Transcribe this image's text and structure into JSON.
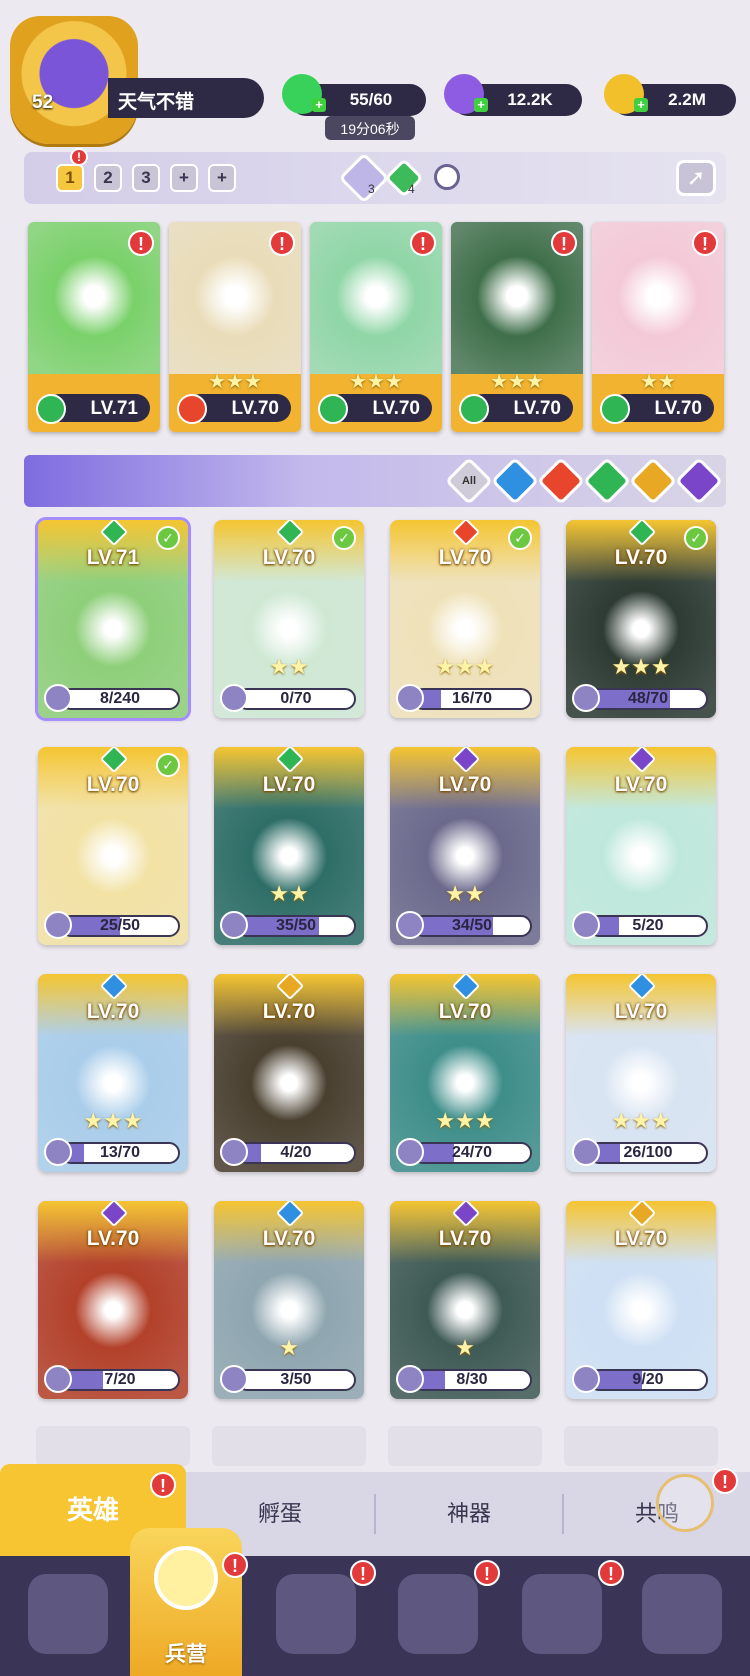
{
  "player": {
    "level": "52",
    "name": "天气不错"
  },
  "resources": {
    "energy": "55/60",
    "energy_timer": "19分06秒",
    "gems": "12.2K",
    "gold": "2.2M"
  },
  "teams": {
    "tabs": [
      "1",
      "2",
      "3",
      "+",
      "+"
    ],
    "active": 0,
    "count_a": "3",
    "count_b": "4"
  },
  "team_heroes": [
    {
      "level": "LV.71",
      "element": "wind",
      "stars": "",
      "color": "#7ad16a"
    },
    {
      "level": "LV.70",
      "element": "fire",
      "stars": "★★★",
      "color": "#e9dcb8"
    },
    {
      "level": "LV.70",
      "element": "wind",
      "stars": "★★★",
      "color": "#8fd6a6"
    },
    {
      "level": "LV.70",
      "element": "wind",
      "stars": "★★★",
      "color": "#3f6f4a"
    },
    {
      "level": "LV.70",
      "element": "wind",
      "stars": "★★",
      "color": "#f4c9d7"
    }
  ],
  "filters": [
    "All",
    "water",
    "fire",
    "wind",
    "light",
    "dark"
  ],
  "elements": {
    "wind": "#2fb553",
    "fire": "#e8462c",
    "water": "#2f8fe0",
    "light": "#e8a823",
    "dark": "#7a45c9"
  },
  "heroes": [
    {
      "level": "LV.71",
      "element": "wind",
      "progress": "8/240",
      "stars": "",
      "check": true,
      "color": "#8ecf7a",
      "sel": true
    },
    {
      "level": "LV.70",
      "element": "wind",
      "progress": "0/70",
      "stars": "★★",
      "check": true,
      "color": "#cfe8d4"
    },
    {
      "level": "LV.70",
      "element": "fire",
      "progress": "16/70",
      "stars": "★★★",
      "check": true,
      "color": "#efe2b9"
    },
    {
      "level": "LV.70",
      "element": "wind",
      "progress": "48/70",
      "stars": "★★★",
      "check": true,
      "color": "#2d3b33"
    },
    {
      "level": "LV.70",
      "element": "wind",
      "progress": "25/50",
      "stars": "",
      "check": true,
      "color": "#f2e2a4"
    },
    {
      "level": "LV.70",
      "element": "wind",
      "progress": "35/50",
      "stars": "★★",
      "check": false,
      "color": "#2e6e67"
    },
    {
      "level": "LV.70",
      "element": "dark",
      "progress": "34/50",
      "stars": "★★",
      "check": false,
      "color": "#6c6a8c"
    },
    {
      "level": "LV.70",
      "element": "dark",
      "progress": "5/20",
      "stars": "",
      "check": false,
      "color": "#bfe8dc"
    },
    {
      "level": "LV.70",
      "element": "water",
      "progress": "13/70",
      "stars": "★★★",
      "check": false,
      "color": "#a9cdea"
    },
    {
      "level": "LV.70",
      "element": "light",
      "progress": "4/20",
      "stars": "",
      "check": false,
      "color": "#4a4030"
    },
    {
      "level": "LV.70",
      "element": "water",
      "progress": "24/70",
      "stars": "★★★",
      "check": false,
      "color": "#3e8e8a"
    },
    {
      "level": "LV.70",
      "element": "water",
      "progress": "26/100",
      "stars": "★★★",
      "check": false,
      "color": "#d8e4f2"
    },
    {
      "level": "LV.70",
      "element": "dark",
      "progress": "7/20",
      "stars": "",
      "check": false,
      "color": "#b3412a"
    },
    {
      "level": "LV.70",
      "element": "water",
      "progress": "3/50",
      "stars": "★",
      "check": false,
      "color": "#8fa6b0"
    },
    {
      "level": "LV.70",
      "element": "dark",
      "progress": "8/30",
      "stars": "★",
      "check": false,
      "color": "#3f5a55"
    },
    {
      "level": "LV.70",
      "element": "light",
      "progress": "9/20",
      "stars": "",
      "check": false,
      "color": "#cfe0f4"
    }
  ],
  "bottom_tabs": [
    "英雄",
    "孵蛋",
    "神器",
    "共鸣"
  ],
  "nav": {
    "active_label": "兵营"
  }
}
